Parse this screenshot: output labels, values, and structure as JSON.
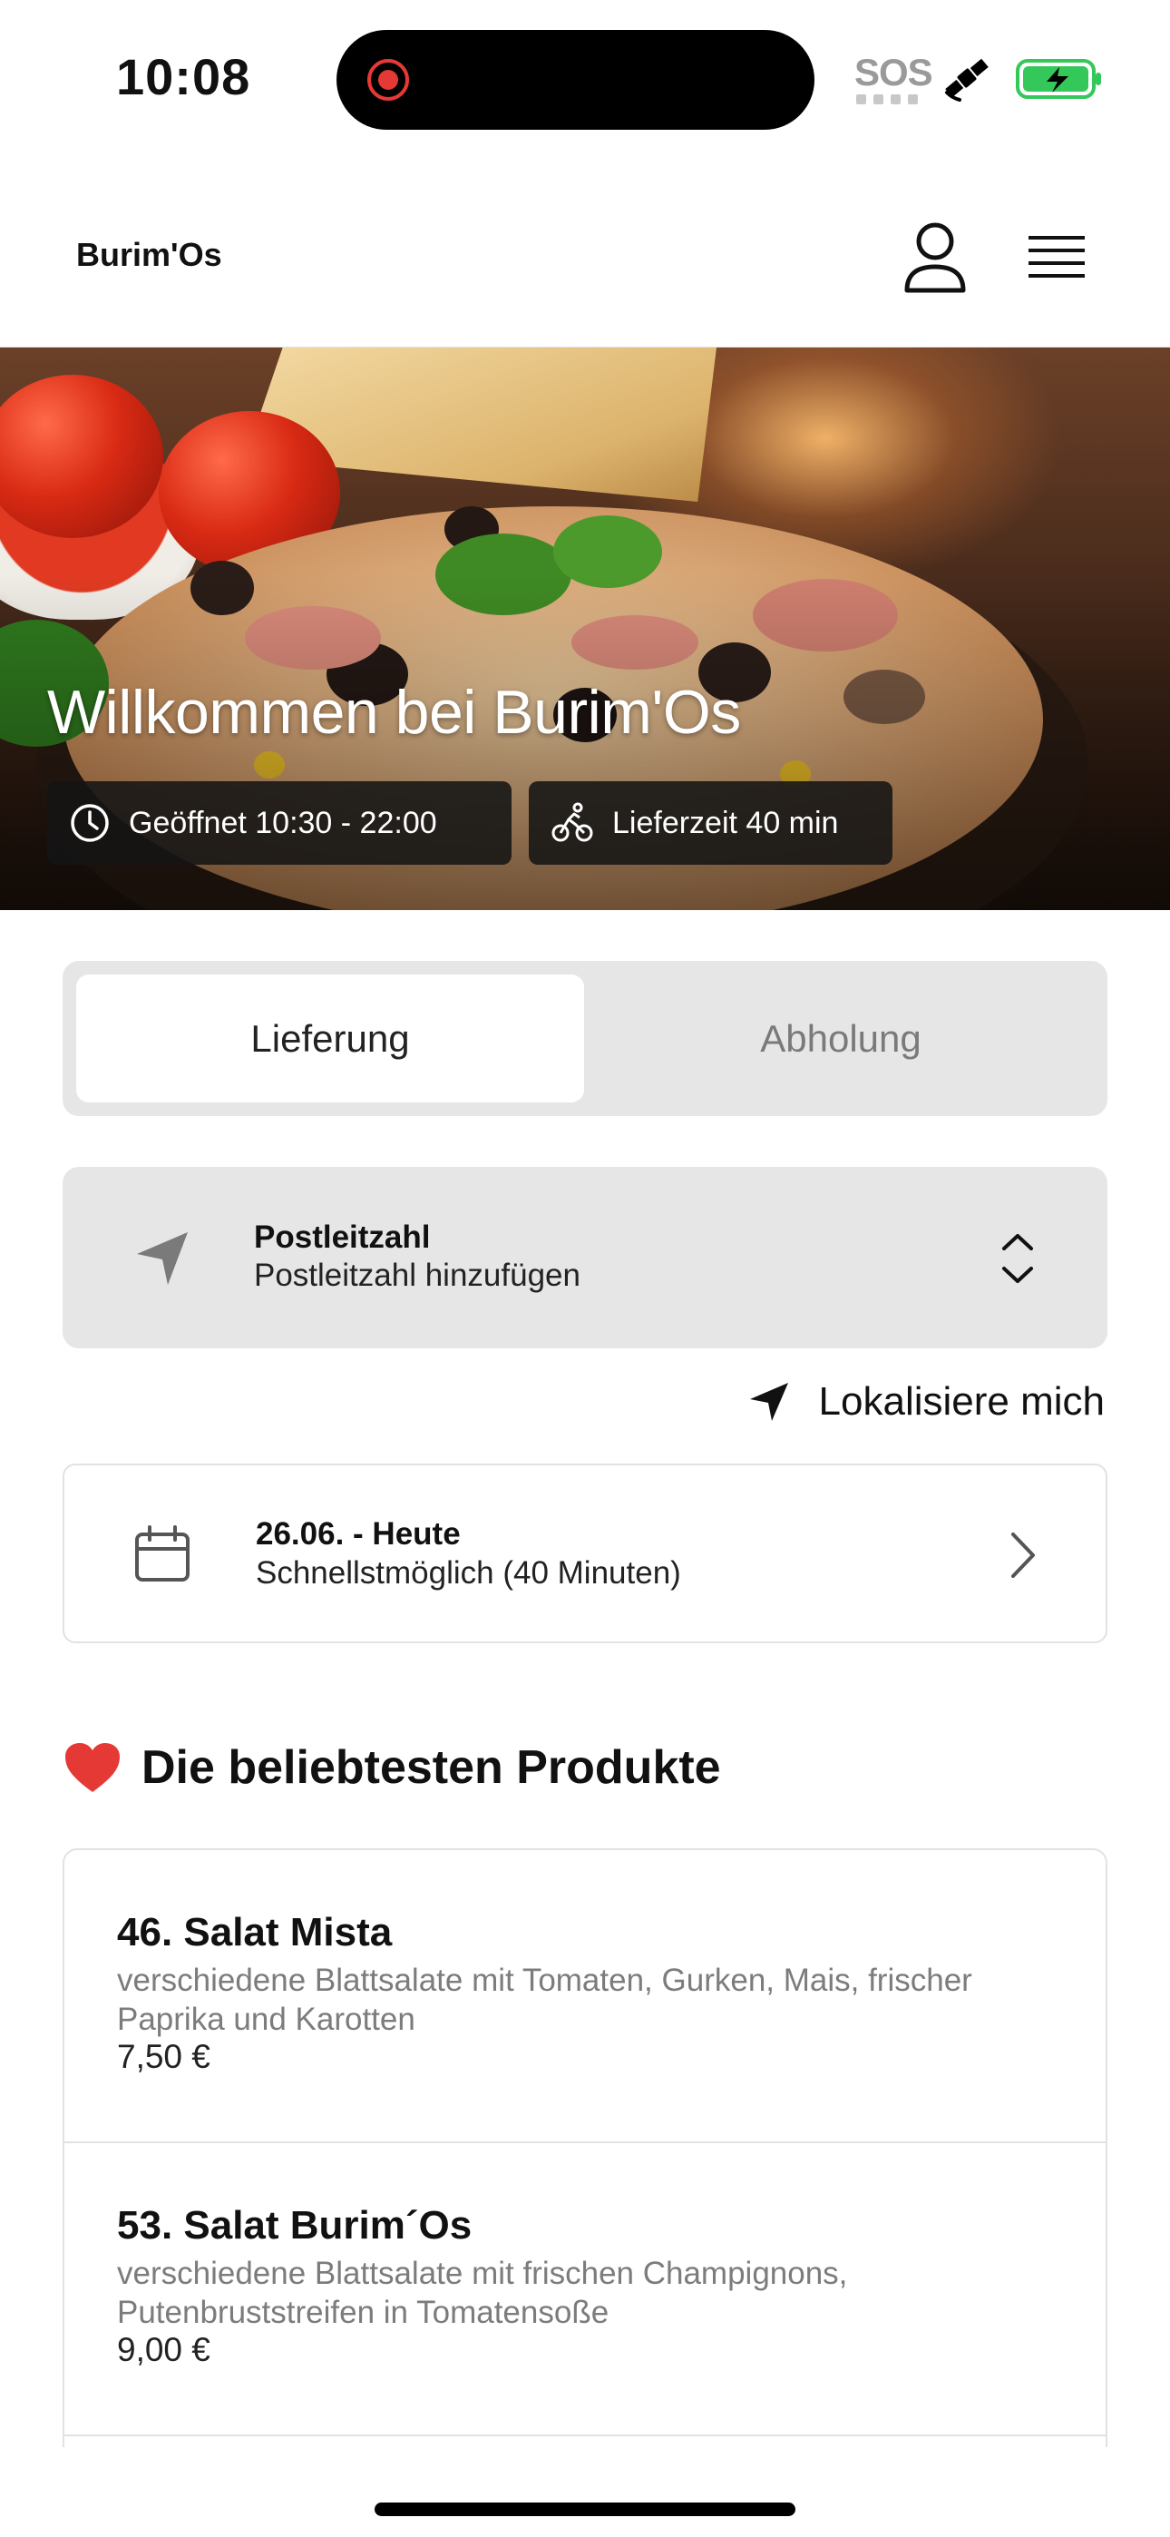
{
  "status_bar": {
    "time": "10:08",
    "sos": "SOS",
    "icons": [
      "screen-recording-icon",
      "satellite-icon",
      "battery-charging-icon"
    ],
    "battery_color": "#34c759"
  },
  "header": {
    "brand": "Burim'Os",
    "icons": [
      "user-icon",
      "menu-icon"
    ]
  },
  "hero": {
    "title": "Willkommen bei Burim'Os",
    "opening_hours": "Geöffnet 10:30 - 22:00",
    "delivery_time": "Lieferzeit 40 min",
    "icons": [
      "clock-icon",
      "bicycle-icon"
    ]
  },
  "order_mode": {
    "tabs": [
      {
        "label": "Lieferung",
        "active": true
      },
      {
        "label": "Abholung",
        "active": false
      }
    ]
  },
  "postal_code": {
    "title": "Postleitzahl",
    "placeholder": "Postleitzahl hinzufügen"
  },
  "locate_me": {
    "label": "Lokalisiere mich"
  },
  "delivery_date": {
    "title": "26.06. - Heute",
    "subtitle": "Schnellstmöglich (40 Minuten)"
  },
  "popular": {
    "heading": "Die beliebtesten Produkte",
    "products": [
      {
        "name": "46. Salat Mista",
        "description": "verschiedene Blattsalate mit Tomaten, Gurken, Mais, frischer Paprika und Karotten",
        "price": "7,50 €"
      },
      {
        "name": "53. Salat Burim´Os",
        "description": "verschiedene Blattsalate mit frischen Champignons, Putenbruststreifen in Tomatensoße",
        "price": "9,00 €"
      }
    ]
  },
  "colors": {
    "accent_red": "#e53935",
    "panel_gray": "#e6e6e6",
    "muted_text": "#7c7c7c"
  }
}
